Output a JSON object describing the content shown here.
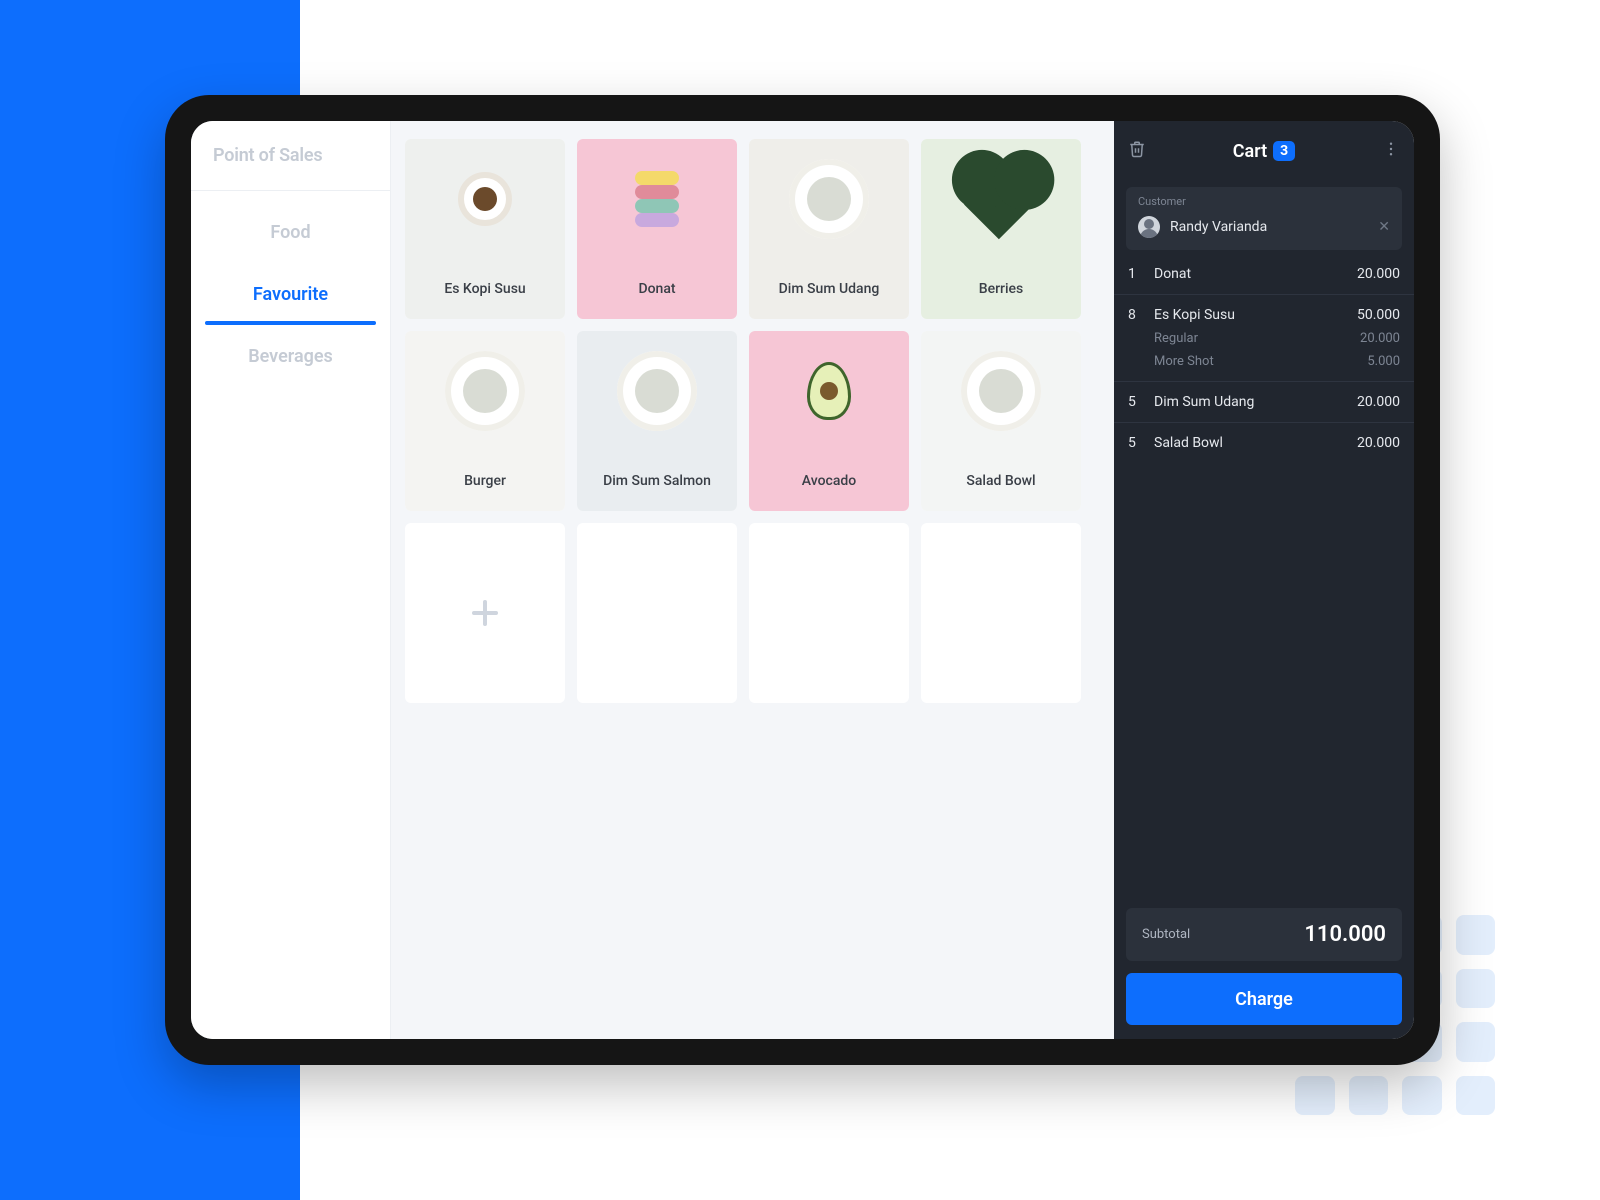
{
  "app_title": "Point of Sales",
  "colors": {
    "accent": "#0D6EFD",
    "cart_bg": "#21262f"
  },
  "categories": [
    {
      "label": "Food",
      "active": false
    },
    {
      "label": "Favourite",
      "active": true
    },
    {
      "label": "Beverages",
      "active": false
    }
  ],
  "products": [
    {
      "name": "Es Kopi Susu",
      "bg": "#eef0ee",
      "glyph": "coffee"
    },
    {
      "name": "Donat",
      "bg": "#f6c6d5",
      "glyph": "macaron"
    },
    {
      "name": "Dim Sum Udang",
      "bg": "#efeeea",
      "glyph": "plate"
    },
    {
      "name": "Berries",
      "bg": "#e6efe1",
      "glyph": "heart"
    },
    {
      "name": "Burger",
      "bg": "#f4f4f2",
      "glyph": "plate"
    },
    {
      "name": "Dim Sum Salmon",
      "bg": "#e9edf0",
      "glyph": "plate"
    },
    {
      "name": "Avocado",
      "bg": "#f6c6d5",
      "glyph": "avocado"
    },
    {
      "name": "Salad Bowl",
      "bg": "#f3f5f4",
      "glyph": "plate"
    }
  ],
  "empty_slots": 4,
  "cart": {
    "title": "Cart",
    "count": "3",
    "customer_label": "Customer",
    "customer_name": "Randy Varianda",
    "items": [
      {
        "qty": "1",
        "name": "Donat",
        "price": "20.000",
        "mods": []
      },
      {
        "qty": "8",
        "name": "Es Kopi Susu",
        "price": "50.000",
        "mods": [
          {
            "name": "Regular",
            "price": "20.000"
          },
          {
            "name": "More Shot",
            "price": "5.000"
          }
        ]
      },
      {
        "qty": "5",
        "name": "Dim Sum Udang",
        "price": "20.000",
        "mods": []
      },
      {
        "qty": "5",
        "name": "Salad Bowl",
        "price": "20.000",
        "mods": []
      }
    ],
    "subtotal_label": "Subtotal",
    "subtotal_value": "110.000",
    "charge_label": "Charge"
  }
}
